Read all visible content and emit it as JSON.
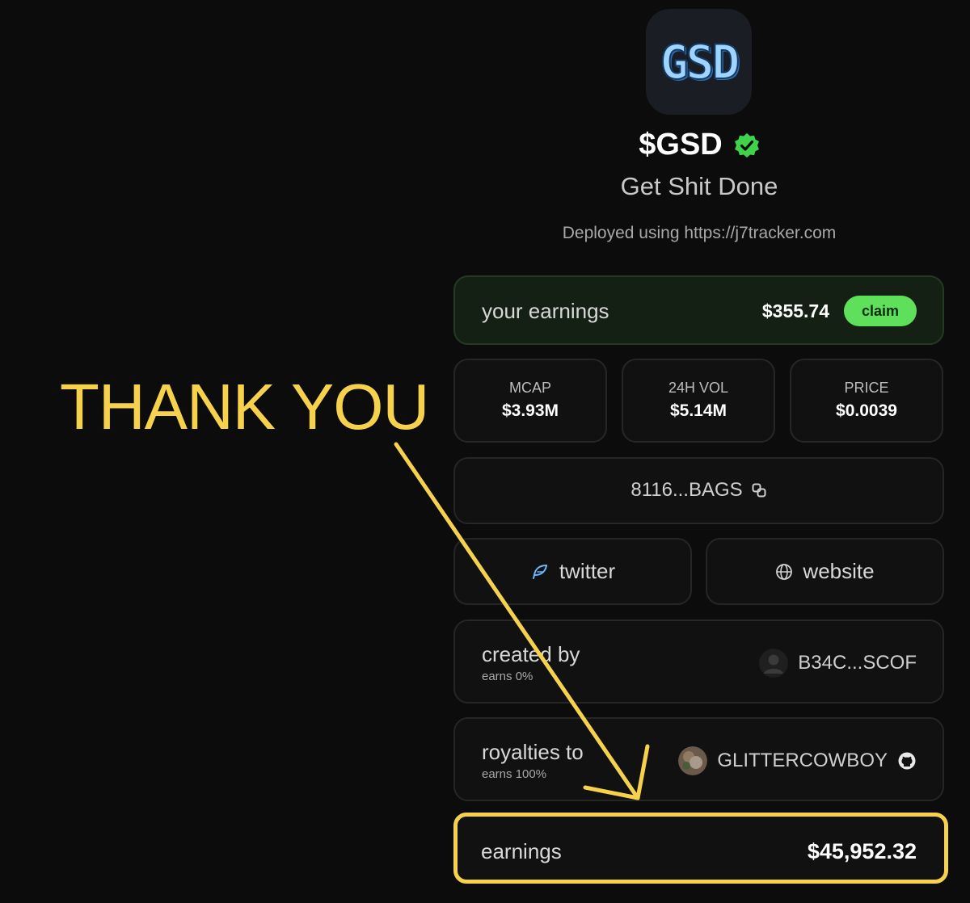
{
  "logo": {
    "text": "GSD"
  },
  "token": {
    "name": "$GSD",
    "tagline": "Get Shit Done",
    "deployed": "Deployed using https://j7tracker.com"
  },
  "your_earnings": {
    "label": "your earnings",
    "value": "$355.74",
    "claim_label": "claim"
  },
  "stats": [
    {
      "label": "MCAP",
      "value": "$3.93M"
    },
    {
      "label": "24H VOL",
      "value": "$5.14M"
    },
    {
      "label": "PRICE",
      "value": "$0.0039"
    }
  ],
  "address": {
    "text": "8116...BAGS"
  },
  "links": {
    "twitter": "twitter",
    "website": "website"
  },
  "created_by": {
    "label": "created by",
    "sub": "earns 0%",
    "user": "B34C...SCOF"
  },
  "royalties": {
    "label": "royalties to",
    "sub": "earns 100%",
    "user": "GLITTERCOWBOY"
  },
  "total_earnings": {
    "label": "earnings",
    "value": "$45,952.32"
  },
  "annotation": {
    "text": "THANK YOU"
  },
  "colors": {
    "accent_green": "#5ee05a",
    "highlight_yellow": "#f6d24c",
    "verified": "#3fd24a"
  },
  "icons": [
    "verified-badge-icon",
    "copy-icon",
    "twitter-feather-icon",
    "globe-icon",
    "github-icon",
    "default-avatar-icon",
    "user-avatar-icon"
  ]
}
